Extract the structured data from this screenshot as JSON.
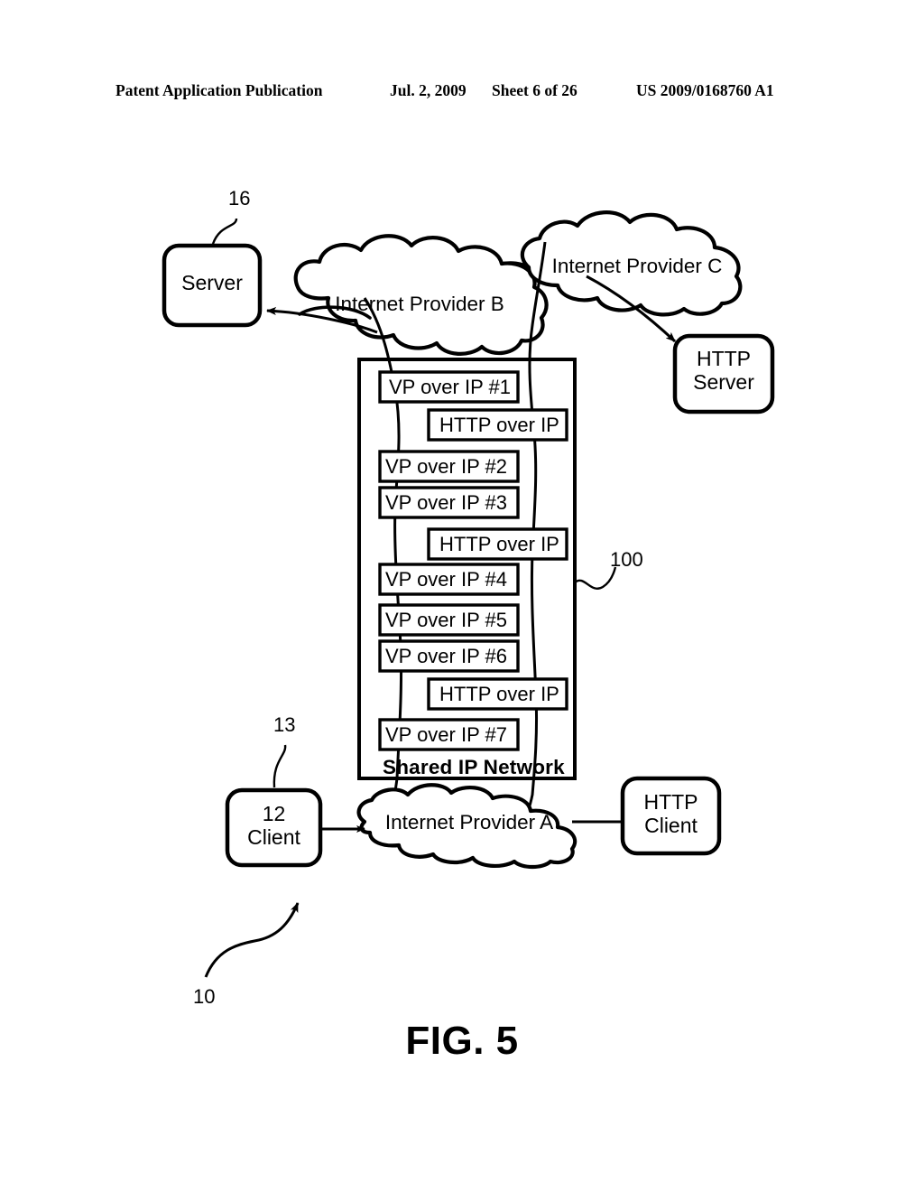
{
  "header": {
    "publication": "Patent Application Publication",
    "date": "Jul. 2, 2009",
    "sheet": "Sheet 6 of 26",
    "number": "US 2009/0168760 A1"
  },
  "figure": {
    "caption": "FIG. 5",
    "nodes": {
      "server": "Server",
      "http_server_line1": "HTTP",
      "http_server_line2": "Server",
      "client_line1": "12",
      "client_line2": "Client",
      "http_client_line1": "HTTP",
      "http_client_line2": "Client"
    },
    "clouds": {
      "provider_a": "Internet Provider A",
      "provider_b": "Internet Provider B",
      "provider_c": "Internet Provider C"
    },
    "shared_network": {
      "title": "Shared IP Network",
      "stack": [
        {
          "label": "VP over IP #1",
          "kind": "vp"
        },
        {
          "label": "HTTP over IP",
          "kind": "http"
        },
        {
          "label": "VP over IP #2",
          "kind": "vp"
        },
        {
          "label": "VP over IP #3",
          "kind": "vp"
        },
        {
          "label": "HTTP over IP",
          "kind": "http"
        },
        {
          "label": "VP over IP #4",
          "kind": "vp"
        },
        {
          "label": "VP over IP #5",
          "kind": "vp"
        },
        {
          "label": "VP over IP #6",
          "kind": "vp"
        },
        {
          "label": "HTTP over IP",
          "kind": "http"
        },
        {
          "label": "VP over IP #7",
          "kind": "vp"
        }
      ]
    },
    "reference_numerals": {
      "server_ref": "16",
      "client_ref": "13",
      "network_ref": "100",
      "system_ref": "10"
    }
  }
}
